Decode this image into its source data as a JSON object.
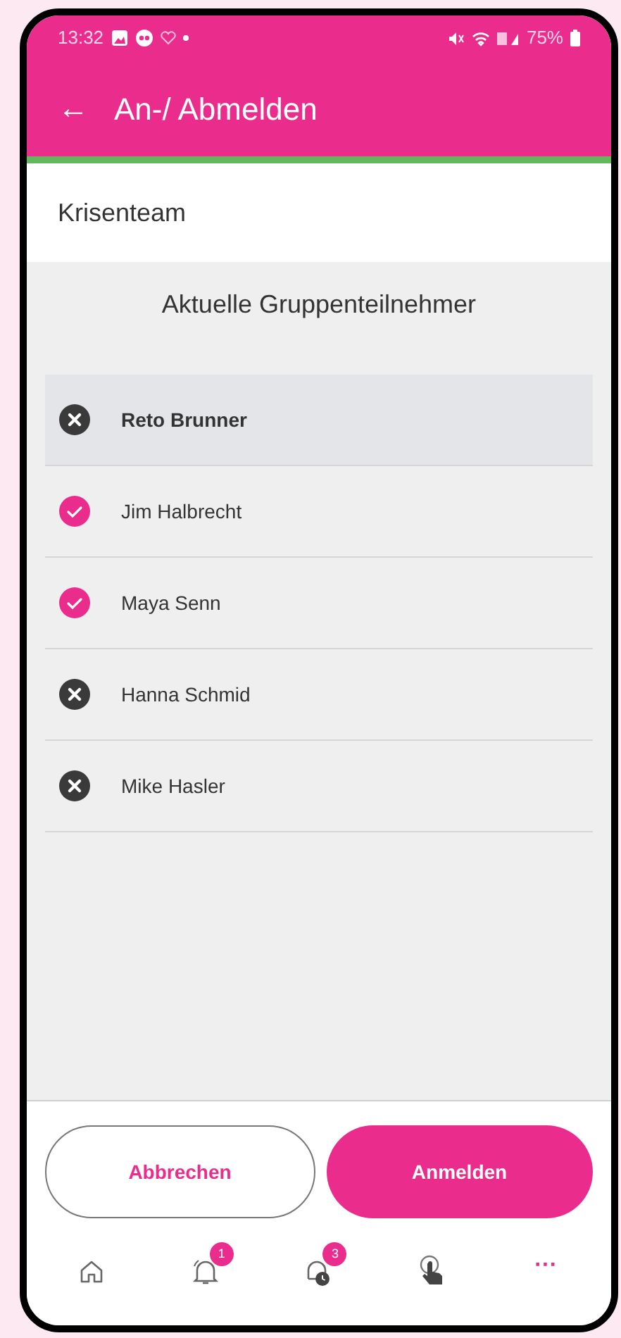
{
  "status_bar": {
    "time": "13:32",
    "battery": "75%"
  },
  "app_bar": {
    "back": "←",
    "title": "An-/ Abmelden"
  },
  "group": {
    "name": "Krisenteam"
  },
  "list_title": "Aktuelle Gruppenteilnehmer",
  "members": [
    {
      "name": "Reto Brunner",
      "checked": false,
      "selected": true
    },
    {
      "name": "Jim Halbrecht",
      "checked": true,
      "selected": false
    },
    {
      "name": "Maya Senn",
      "checked": true,
      "selected": false
    },
    {
      "name": "Hanna Schmid",
      "checked": false,
      "selected": false
    },
    {
      "name": "Mike Hasler",
      "checked": false,
      "selected": false
    }
  ],
  "buttons": [
    {
      "kind": "outline",
      "label": "Abbrechen"
    },
    {
      "kind": "filled",
      "label": "Anmelden"
    }
  ],
  "nav": [
    {
      "kind": "home"
    },
    {
      "kind": "bell",
      "badge": "1"
    },
    {
      "kind": "bell-clock",
      "badge": "3"
    },
    {
      "kind": "touch"
    },
    {
      "kind": "more",
      "label": "···"
    }
  ]
}
